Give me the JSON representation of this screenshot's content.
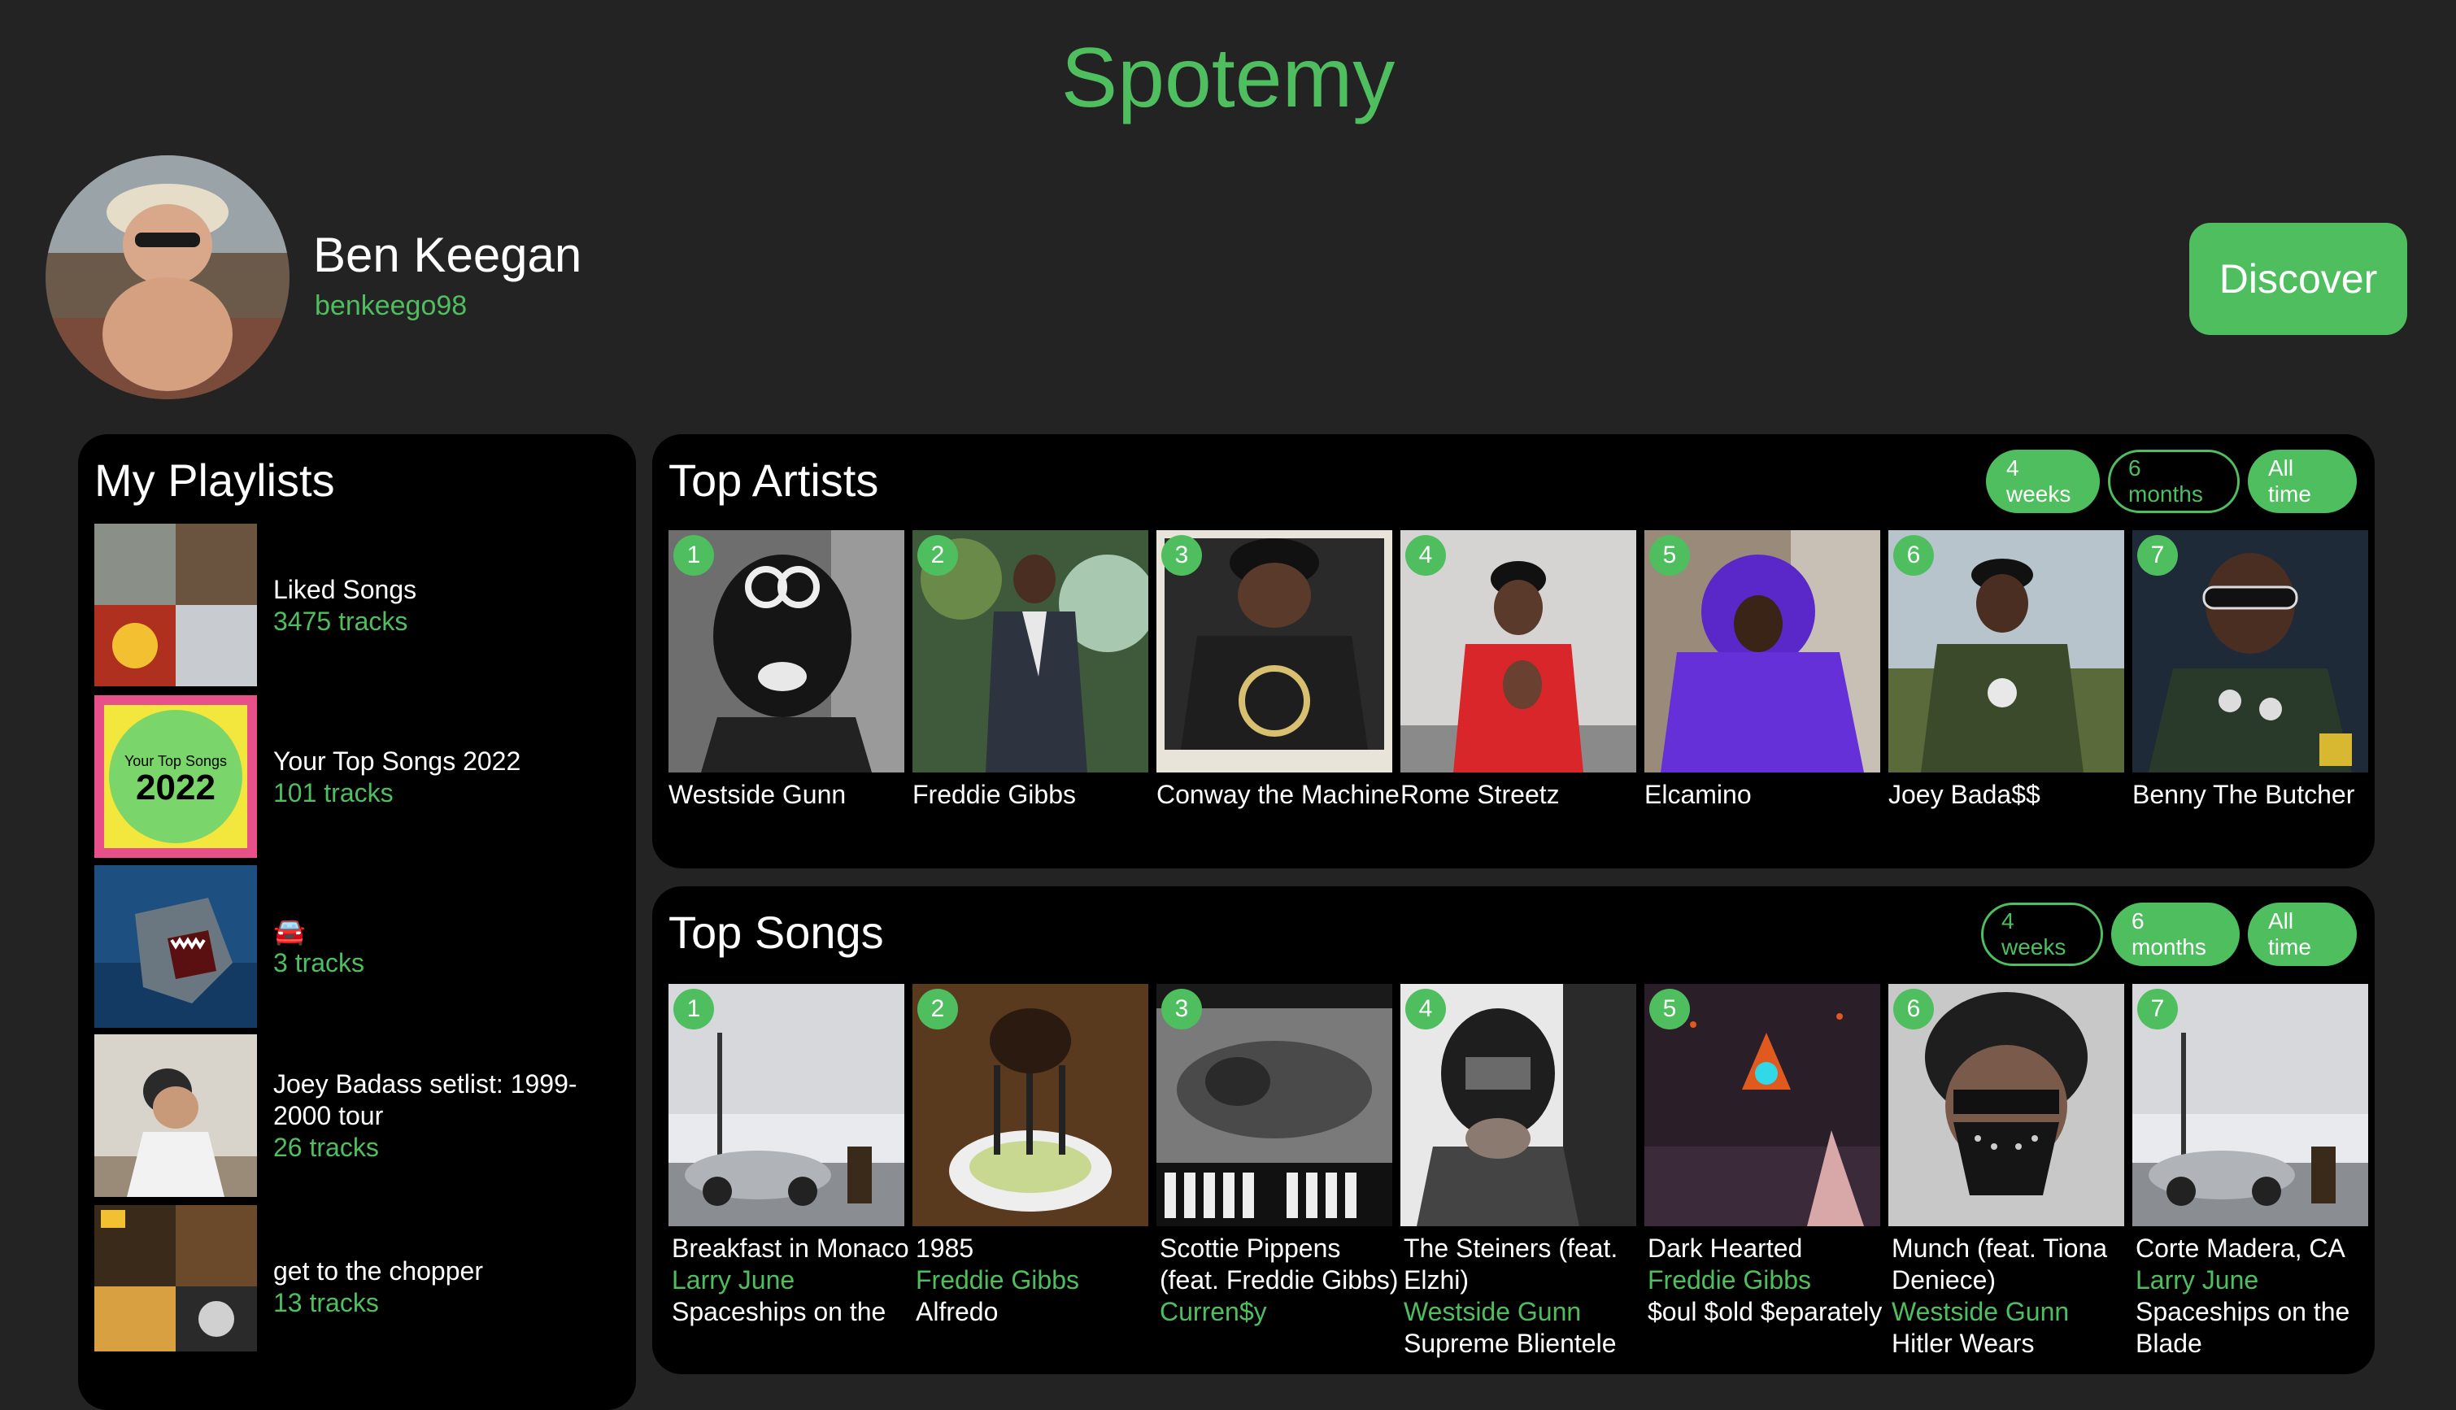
{
  "app": {
    "title": "Spotemy"
  },
  "user": {
    "name": "Ben Keegan",
    "handle": "benkeego98"
  },
  "discover_label": "Discover",
  "colors": {
    "accent": "#4fbe5f",
    "background": "#232323",
    "panel": "#000000"
  },
  "playlists": {
    "title": "My Playlists",
    "items": [
      {
        "name": "Liked Songs",
        "count": "3475 tracks",
        "cover": "mosaic"
      },
      {
        "name": "Your Top Songs 2022",
        "count": "101 tracks",
        "cover": "your-top-songs",
        "cover_text_small": "Your Top Songs",
        "cover_text_year": "2022"
      },
      {
        "name": "🚘",
        "count": "3 tracks",
        "cover": "shark"
      },
      {
        "name": "Joey Badass setlist: 1999-2000 tour",
        "count": "26 tracks",
        "cover": "photo"
      },
      {
        "name": "get to the chopper",
        "count": "13 tracks",
        "cover": "mosaic"
      }
    ]
  },
  "top_artists": {
    "title": "Top Artists",
    "ranges": [
      "4 weeks",
      "6 months",
      "All time"
    ],
    "selected": [
      "4 weeks",
      "All time"
    ],
    "items": [
      {
        "rank": "1",
        "name": "Westside Gunn"
      },
      {
        "rank": "2",
        "name": "Freddie Gibbs"
      },
      {
        "rank": "3",
        "name": "Conway the Machine"
      },
      {
        "rank": "4",
        "name": "Rome Streetz"
      },
      {
        "rank": "5",
        "name": "Elcamino"
      },
      {
        "rank": "6",
        "name": "Joey Bada$$"
      },
      {
        "rank": "7",
        "name": "Benny The Butcher"
      }
    ]
  },
  "top_songs": {
    "title": "Top Songs",
    "ranges": [
      "4 weeks",
      "6 months",
      "All time"
    ],
    "selected": [
      "6 months",
      "All time"
    ],
    "items": [
      {
        "rank": "1",
        "title": "Breakfast in Monaco",
        "artist": "Larry June",
        "album": "Spaceships on the"
      },
      {
        "rank": "2",
        "title": "1985",
        "artist": "Freddie Gibbs",
        "album": "Alfredo"
      },
      {
        "rank": "3",
        "title": "Scottie Pippens (feat. Freddie Gibbs)",
        "artist": "Curren$y",
        "album": ""
      },
      {
        "rank": "4",
        "title": "The Steiners (feat. Elzhi)",
        "artist": "Westside Gunn",
        "album": "Supreme Blientele"
      },
      {
        "rank": "5",
        "title": "Dark Hearted",
        "artist": "Freddie Gibbs",
        "album": "$oul $old $eparately"
      },
      {
        "rank": "6",
        "title": "Munch (feat. Tiona Deniece)",
        "artist": "Westside Gunn",
        "album": "Hitler Wears"
      },
      {
        "rank": "7",
        "title": "Corte Madera, CA",
        "artist": "Larry June",
        "album": "Spaceships on the Blade"
      }
    ]
  }
}
